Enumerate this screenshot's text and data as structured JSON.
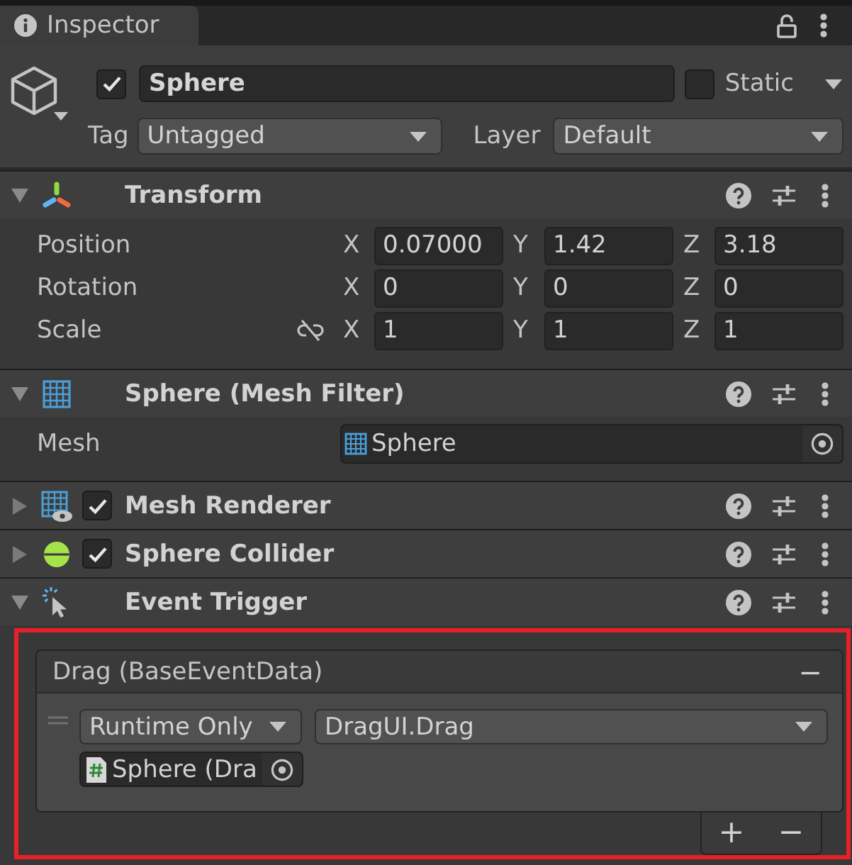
{
  "tab": {
    "title": "Inspector"
  },
  "game_object": {
    "active": true,
    "name": "Sphere",
    "static": false,
    "static_label": "Static",
    "tag_label": "Tag",
    "tag": "Untagged",
    "layer_label": "Layer",
    "layer": "Default"
  },
  "components": [
    {
      "kind": "transform",
      "title": "Transform",
      "expanded": true,
      "rows": [
        {
          "kind": "vector",
          "label": "Position",
          "values": [
            {
              "axis": "X",
              "value": "0.07000"
            },
            {
              "axis": "Y",
              "value": "1.42"
            },
            {
              "axis": "Z",
              "value": "3.18"
            }
          ]
        },
        {
          "kind": "vector",
          "label": "Rotation",
          "values": [
            {
              "axis": "X",
              "value": "0"
            },
            {
              "axis": "Y",
              "value": "0"
            },
            {
              "axis": "Z",
              "value": "0"
            }
          ]
        },
        {
          "kind": "scale",
          "label": "Scale",
          "linked": false,
          "values": [
            {
              "axis": "X",
              "value": "1"
            },
            {
              "axis": "Y",
              "value": "1"
            },
            {
              "axis": "Z",
              "value": "1"
            }
          ]
        }
      ]
    },
    {
      "kind": "mesh_filter",
      "title": "Sphere (Mesh Filter)",
      "expanded": true,
      "fields": [
        {
          "label": "Mesh",
          "value": "Sphere"
        }
      ]
    },
    {
      "kind": "mesh_renderer",
      "title": "Mesh Renderer",
      "expanded": false,
      "enabled": true
    },
    {
      "kind": "sphere_collider",
      "title": "Sphere Collider",
      "expanded": false,
      "enabled": true
    },
    {
      "kind": "event_trigger",
      "title": "Event Trigger",
      "expanded": true,
      "highlighted": true,
      "entries": [
        {
          "title": "Drag (BaseEventData)",
          "remove_label": "−",
          "calls": [
            {
              "mode": "Runtime Only",
              "function": "DragUI.Drag",
              "target": "Sphere (Dra"
            }
          ]
        }
      ],
      "footer_buttons": [
        "+",
        "−"
      ]
    }
  ]
}
